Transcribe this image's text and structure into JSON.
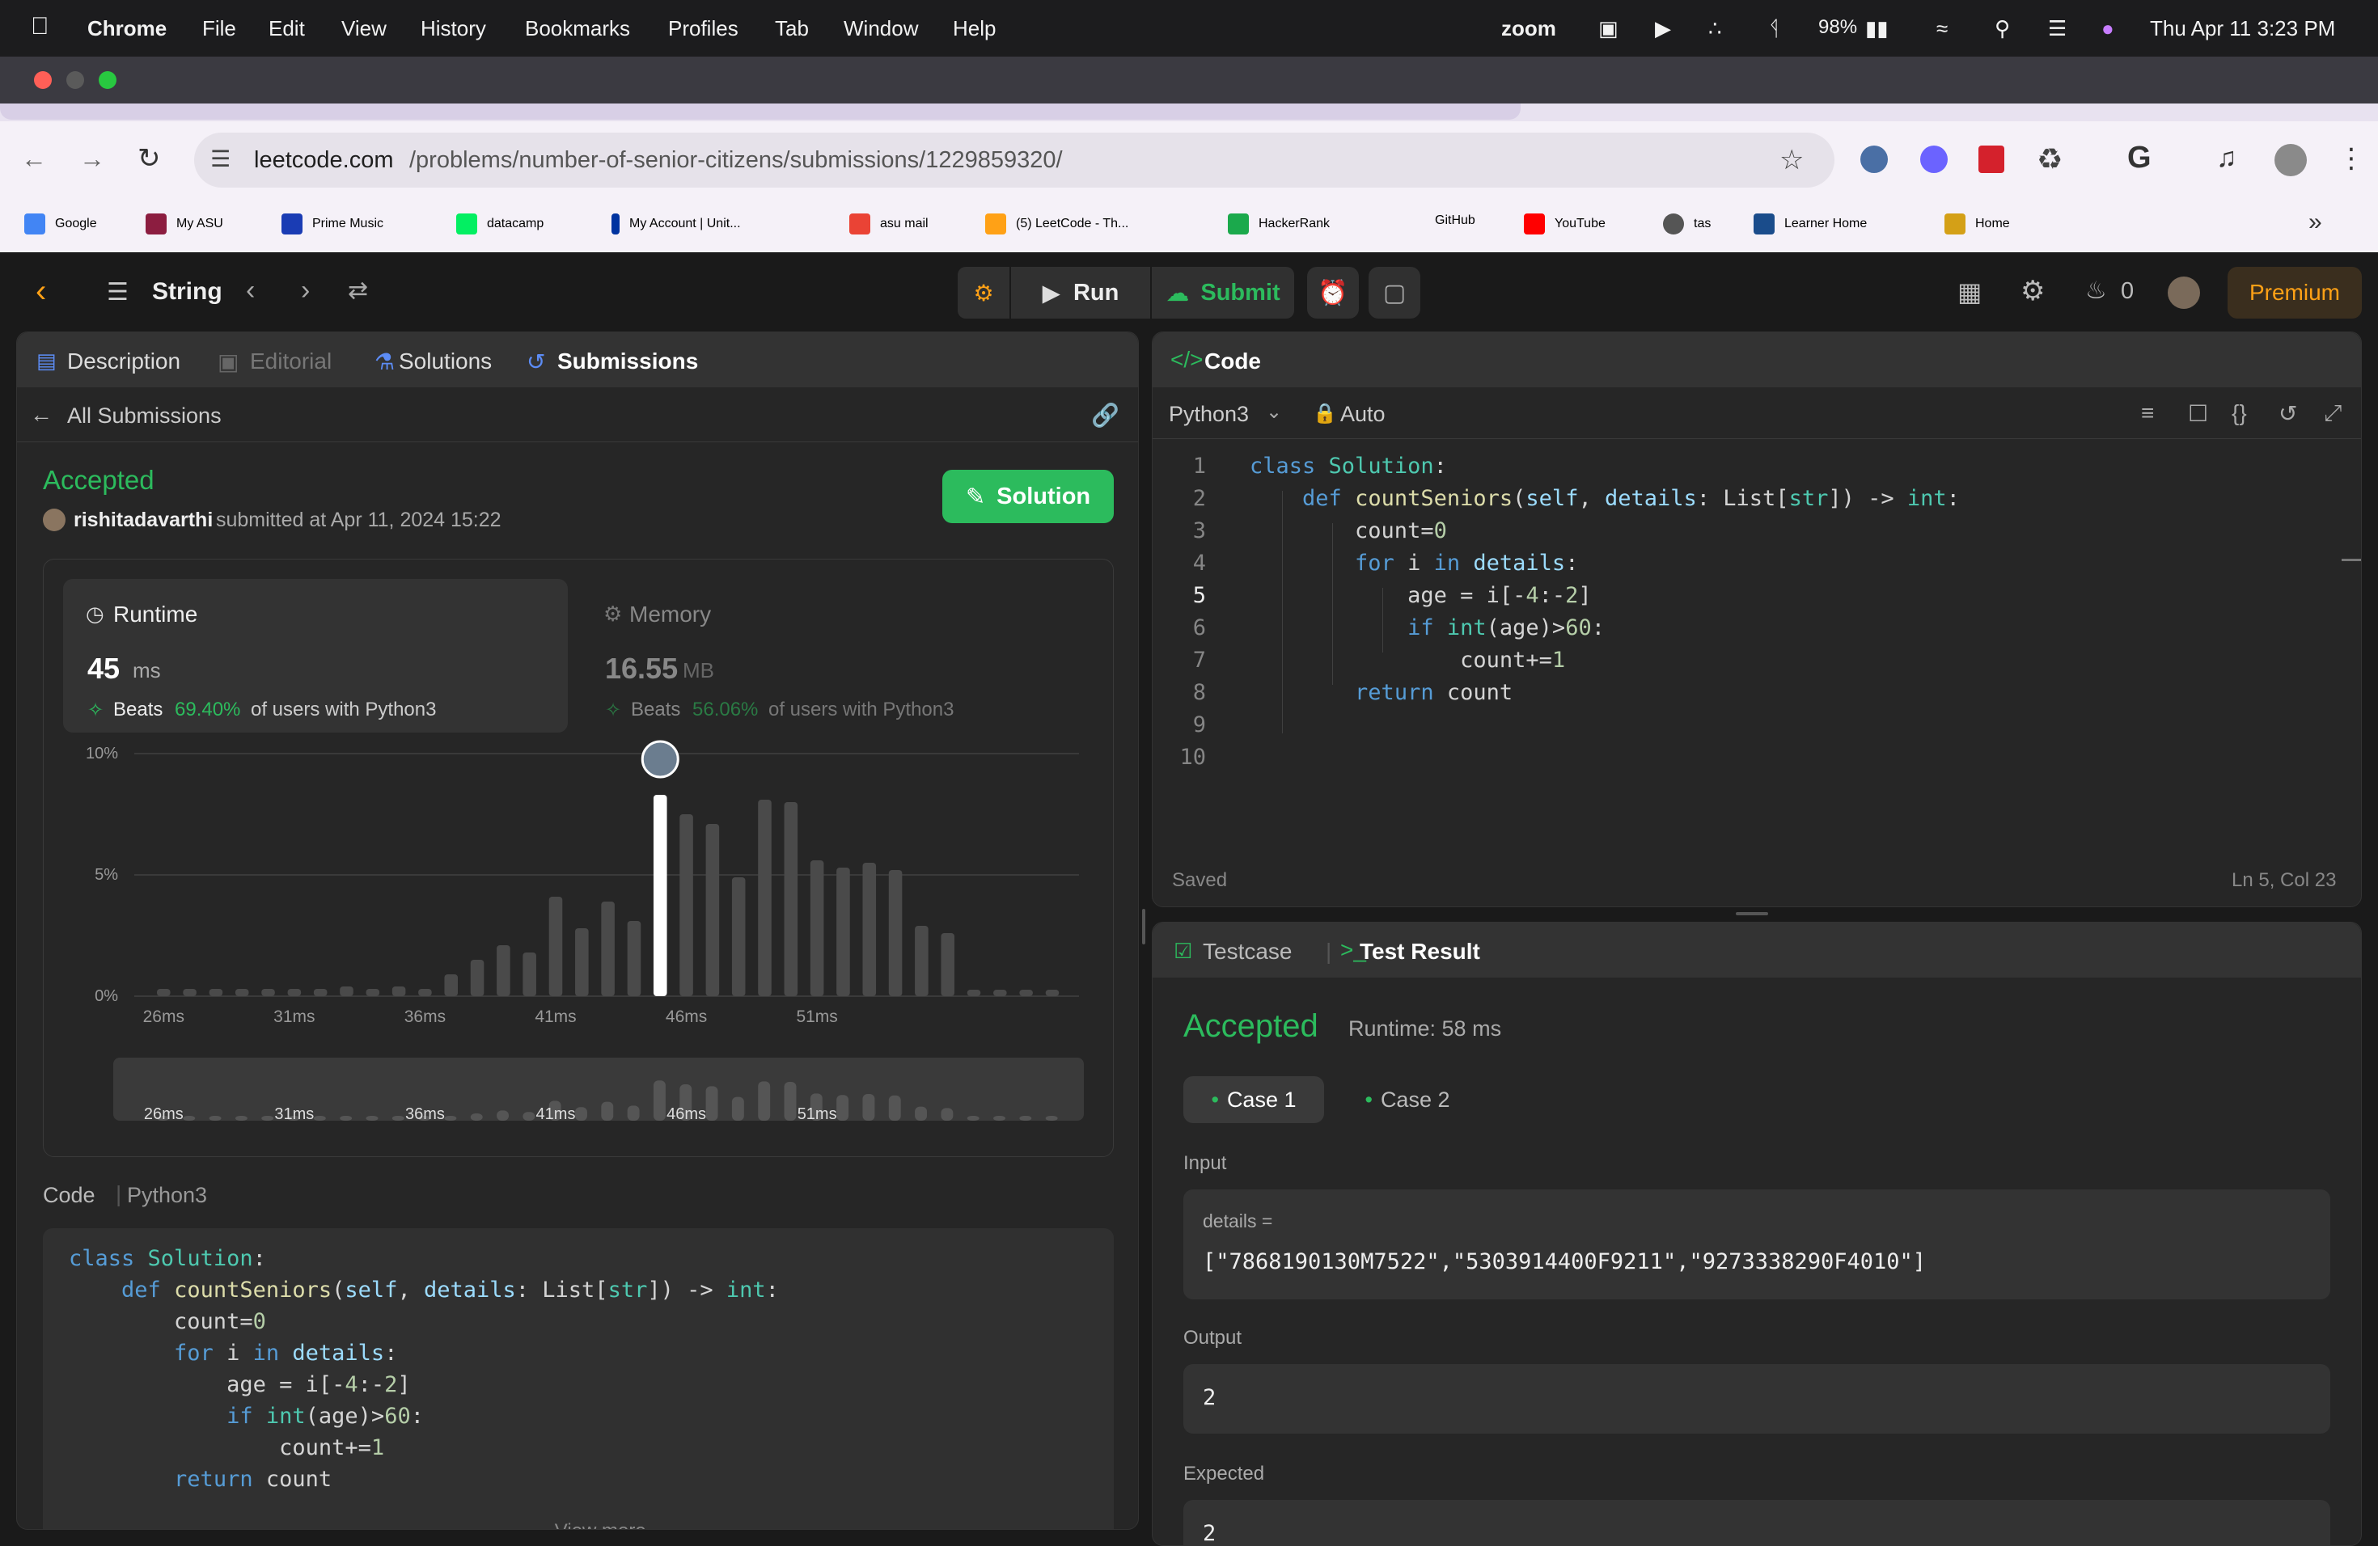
{
  "menubar": {
    "app": "Chrome",
    "items": [
      "File",
      "Edit",
      "View",
      "History",
      "Bookmarks",
      "Profiles",
      "Tab",
      "Window",
      "Help"
    ],
    "zoom": "zoom",
    "battery": "98%",
    "datetime": "Thu Apr 11  3:23 PM"
  },
  "browser": {
    "url_domain": "leetcode.com",
    "url_path": "/problems/number-of-senior-citizens/submissions/1229859320/"
  },
  "bookmarks": [
    {
      "label": "Google",
      "color": "#4285f4"
    },
    {
      "label": "My ASU",
      "color": "#8c1d40"
    },
    {
      "label": "Prime Music",
      "color": "#1a3cb4"
    },
    {
      "label": "datacamp",
      "color": "#03ef62"
    },
    {
      "label": "My Account | Unit...",
      "color": "#0033a0"
    },
    {
      "label": "asu mail",
      "color": "#ea4335"
    },
    {
      "label": "(5) LeetCode - Th...",
      "color": "#ffa116"
    },
    {
      "label": "HackerRank",
      "color": "#1ba94c"
    },
    {
      "label": "GitHub",
      "color": "#24292e"
    },
    {
      "label": "YouTube",
      "color": "#ff0000"
    },
    {
      "label": "tas",
      "color": "#555555"
    },
    {
      "label": "Learner Home",
      "color": "#1a4c8b"
    },
    {
      "label": "Home",
      "color": "#d4a017"
    }
  ],
  "lcnav": {
    "problem_list": "String",
    "run": "Run",
    "submit": "Submit",
    "streak": "0",
    "premium": "Premium"
  },
  "left": {
    "tabs": {
      "description": "Description",
      "editorial": "Editorial",
      "solutions": "Solutions",
      "submissions": "Submissions"
    },
    "back": "All Submissions",
    "status": "Accepted",
    "user": "rishitadavarthi",
    "submitted": "submitted at Apr 11, 2024 15:22",
    "solution_btn": "Solution",
    "runtime": {
      "label": "Runtime",
      "value": "45",
      "unit": "ms",
      "beats_pre": "Beats",
      "beats_pct": "69.40%",
      "beats_post": "of users with Python3"
    },
    "memory": {
      "label": "Memory",
      "value": "16.55",
      "unit": "MB",
      "beats_pre": "Beats",
      "beats_pct": "56.06%",
      "beats_post": "of users with Python3"
    },
    "code_label": "Code",
    "code_lang": "Python3",
    "view_more": "View more"
  },
  "chart_data": {
    "type": "bar",
    "ylabel_ticks": [
      "10%",
      "5%",
      "0%"
    ],
    "ylim": [
      0,
      10
    ],
    "xticks": [
      "26ms",
      "31ms",
      "36ms",
      "41ms",
      "46ms",
      "51ms"
    ],
    "categories": [
      "26ms",
      "27ms",
      "28ms",
      "29ms",
      "30ms",
      "31ms",
      "32ms",
      "33ms",
      "34ms",
      "35ms",
      "36ms",
      "37ms",
      "38ms",
      "39ms",
      "40ms",
      "41ms",
      "42ms",
      "43ms",
      "44ms",
      "45ms",
      "46ms",
      "47ms",
      "48ms",
      "49ms",
      "50ms",
      "51ms",
      "52ms",
      "53ms",
      "54ms",
      "55ms",
      "56ms",
      "57ms",
      "58ms",
      "59ms",
      "60ms"
    ],
    "values": [
      0.3,
      0.3,
      0.3,
      0.3,
      0.3,
      0.3,
      0.3,
      0.4,
      0.3,
      0.4,
      0.3,
      0.9,
      1.5,
      2.1,
      1.8,
      4.1,
      2.8,
      3.9,
      3.1,
      8.3,
      7.5,
      7.1,
      4.9,
      8.1,
      8.0,
      5.6,
      5.3,
      5.5,
      5.2,
      2.9,
      2.6,
      0,
      0,
      0,
      0
    ],
    "highlight": "45ms",
    "grid": true
  },
  "right": {
    "code_tab": "Code",
    "lang": "Python3",
    "auto": "Auto",
    "saved": "Saved",
    "cursor": "Ln 5, Col 23",
    "testcase_tab": "Testcase",
    "result_tab": "Test Result",
    "result_status": "Accepted",
    "result_runtime": "Runtime: 58 ms",
    "case1": "Case 1",
    "case2": "Case 2",
    "input_label": "Input",
    "input_var": "details =",
    "input_value": "[\"7868190130M7522\",\"5303914400F9211\",\"9273338290F4010\"]",
    "output_label": "Output",
    "output_value": "2",
    "expected_label": "Expected",
    "expected_value": "2"
  },
  "code_lines": [
    "class Solution:",
    "    def countSeniors(self, details: List[str]) -> int:",
    "        count=0",
    "        for i in details:",
    "            age = i[-4:-2]",
    "            if int(age)>60:",
    "                count+=1",
    "        return count",
    "",
    ""
  ]
}
